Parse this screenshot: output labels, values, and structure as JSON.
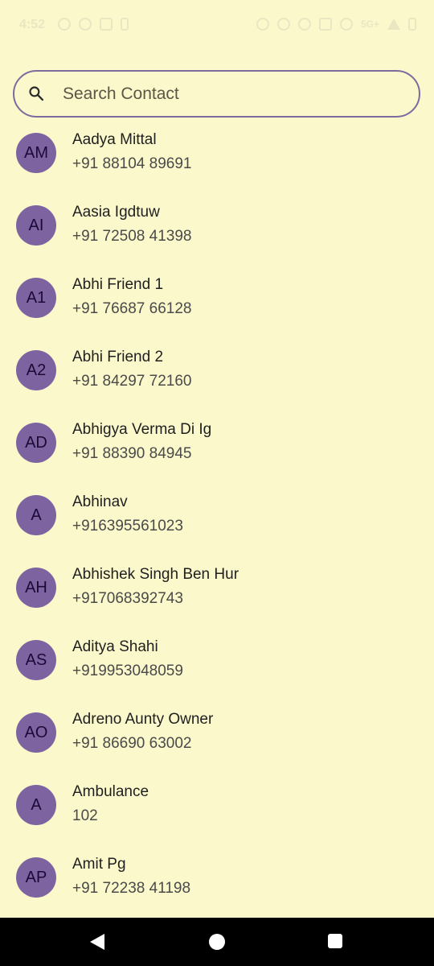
{
  "status_bar": {
    "time": "4:52",
    "network": "5G+"
  },
  "search": {
    "placeholder": "Search Contact"
  },
  "contacts": [
    {
      "initials": "AM",
      "name": "Aadya Mittal",
      "phone": "+91 88104 89691"
    },
    {
      "initials": "AI",
      "name": "Aasia Igdtuw",
      "phone": "+91 72508 41398"
    },
    {
      "initials": "A1",
      "name": "Abhi Friend 1",
      "phone": "+91 76687 66128"
    },
    {
      "initials": "A2",
      "name": "Abhi Friend 2",
      "phone": "+91 84297 72160"
    },
    {
      "initials": "AD",
      "name": "Abhigya Verma Di Ig",
      "phone": "+91 88390 84945"
    },
    {
      "initials": "A",
      "name": "Abhinav",
      "phone": "+916395561023"
    },
    {
      "initials": "AH",
      "name": "Abhishek Singh Ben Hur",
      "phone": "+917068392743"
    },
    {
      "initials": "AS",
      "name": "Aditya Shahi",
      "phone": "+919953048059"
    },
    {
      "initials": "AO",
      "name": "Adreno Aunty Owner",
      "phone": "+91 86690 63002"
    },
    {
      "initials": "A",
      "name": "Ambulance",
      "phone": "102"
    },
    {
      "initials": "AP",
      "name": "Amit Pg",
      "phone": "+91 72238 41198"
    }
  ]
}
